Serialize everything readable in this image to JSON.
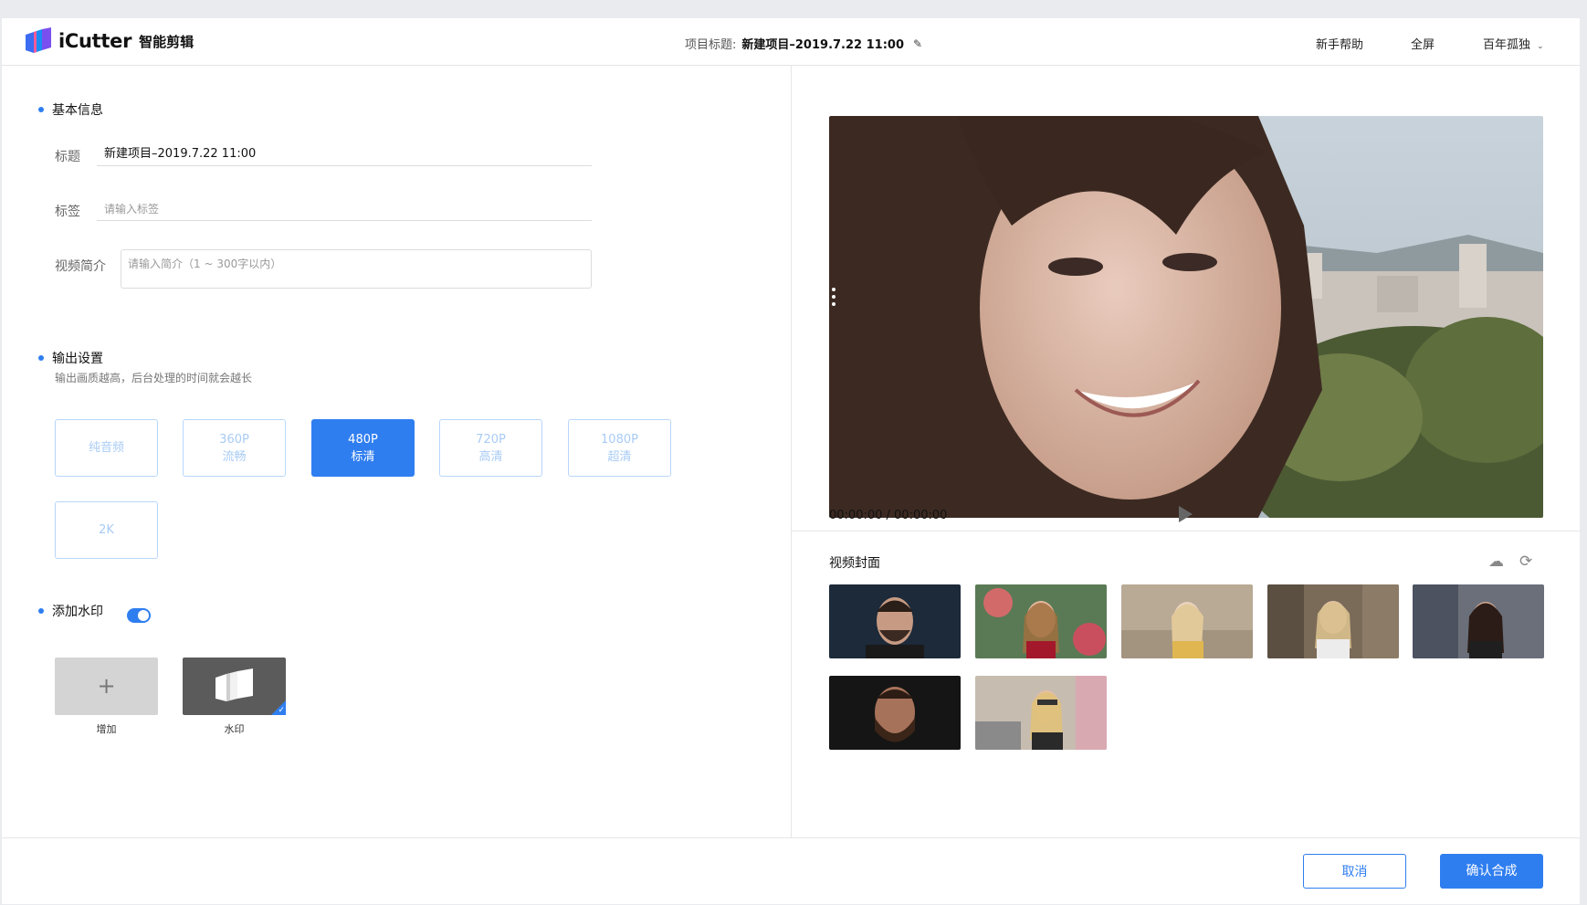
{
  "header": {
    "app_name": "iCutter",
    "app_sub": "智能剪辑",
    "project_label": "项目标题:",
    "project_title": "新建项目–2019.7.22 11:00",
    "help": "新手帮助",
    "fullscreen": "全屏",
    "user": "百年孤独"
  },
  "basic": {
    "section_title": "基本信息",
    "title_label": "标题",
    "title_value": "新建项目–2019.7.22 11:00",
    "tag_label": "标签",
    "tag_placeholder": "请输入标签",
    "intro_label": "视频简介",
    "intro_placeholder": "请输入简介（1 ~ 300字以内）"
  },
  "output": {
    "section_title": "输出设置",
    "desc": "输出画质越高，后台处理的时间就会越长",
    "options": [
      {
        "line1": "纯音频",
        "line2": "",
        "selected": false
      },
      {
        "line1": "360P",
        "line2": "流畅",
        "selected": false
      },
      {
        "line1": "480P",
        "line2": "标清",
        "selected": true
      },
      {
        "line1": "720P",
        "line2": "高清",
        "selected": false
      },
      {
        "line1": "1080P",
        "line2": "超清",
        "selected": false
      },
      {
        "line1": "2K",
        "line2": "",
        "selected": false
      }
    ]
  },
  "watermark": {
    "section_title": "添加水印",
    "enabled": true,
    "add_symbol": "+",
    "add_caption": "增加",
    "item_caption": "水印"
  },
  "player": {
    "time": "00:00:00 / 00:00:00"
  },
  "cover": {
    "title": "视频封面",
    "thumb_count": 7
  },
  "footer": {
    "cancel": "取消",
    "confirm": "确认合成"
  },
  "colors": {
    "accent": "#2f7ef0",
    "inactive_border": "#b9d6fb",
    "inactive_text": "#a8cbf5"
  }
}
